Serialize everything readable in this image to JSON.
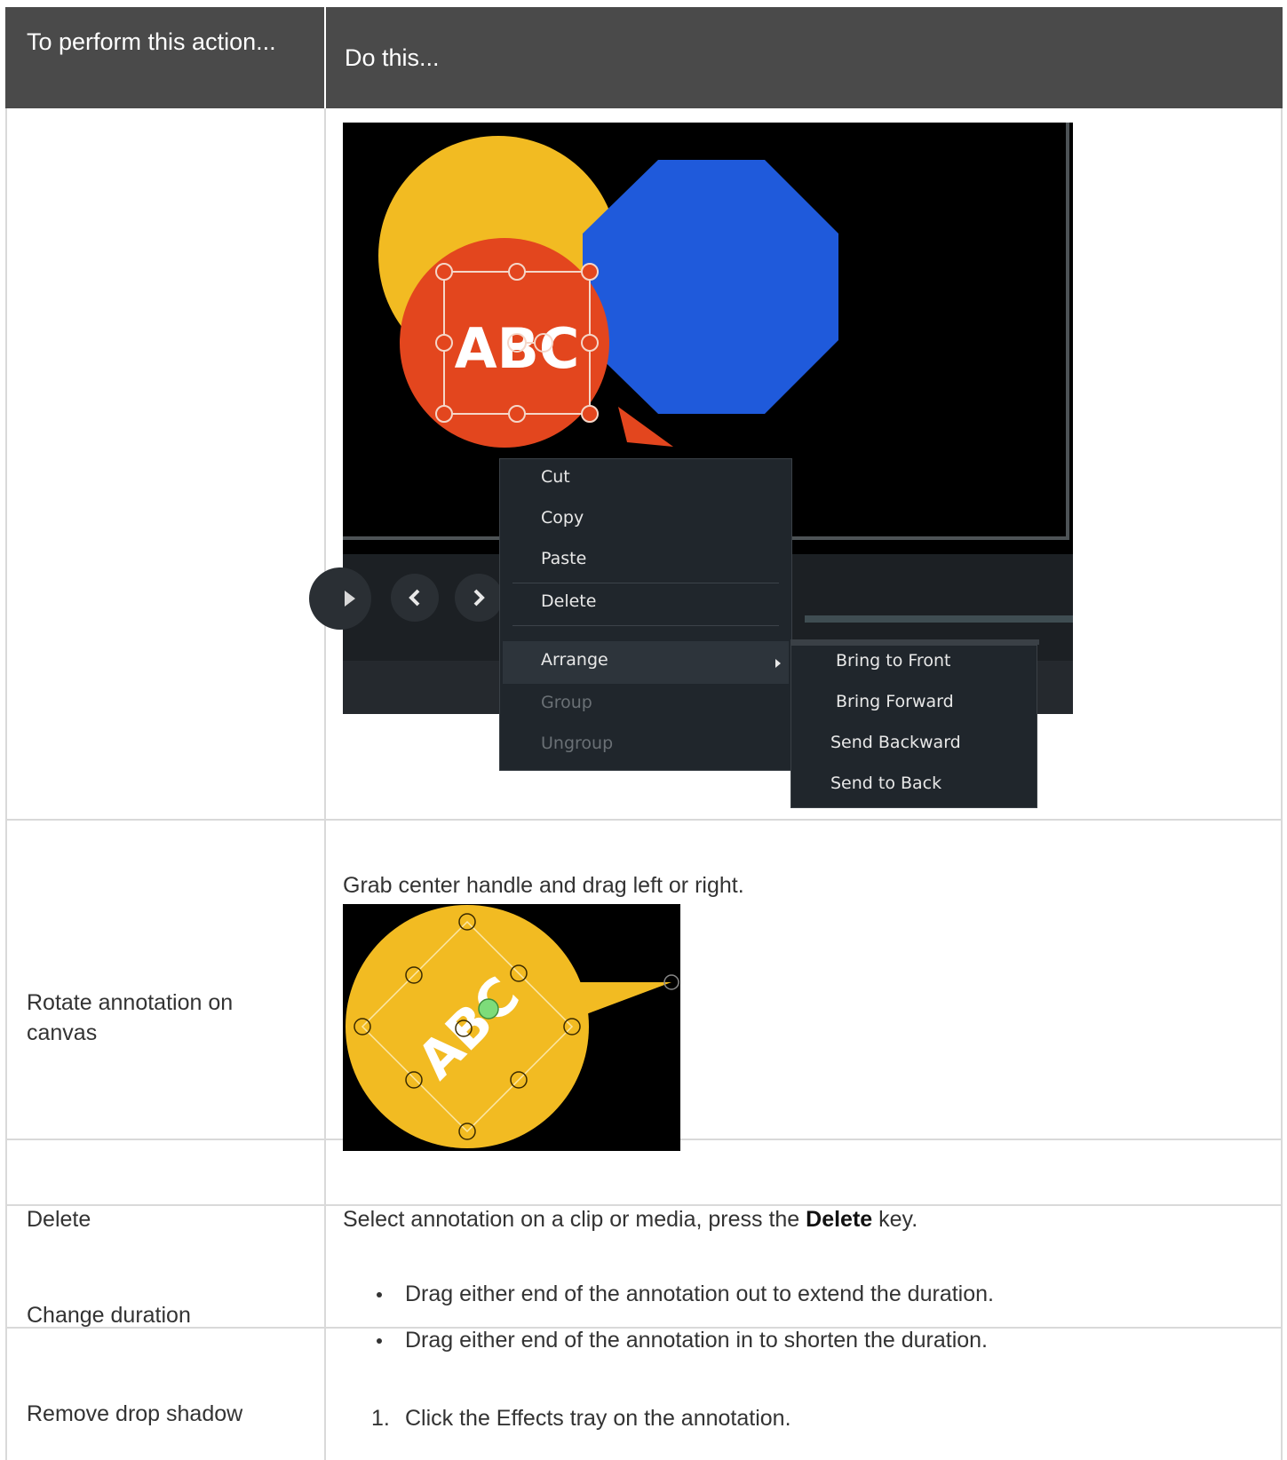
{
  "header": {
    "col1": "To perform this action...",
    "col2": "Do this..."
  },
  "arrange_screenshot": {
    "annotation_text": "ABC",
    "context_menu": {
      "items": [
        "Cut",
        "Copy",
        "Paste",
        "Delete",
        "Arrange",
        "Group",
        "Ungroup"
      ],
      "disabled": [
        "Group",
        "Ungroup"
      ],
      "highlighted": "Arrange"
    },
    "submenu": {
      "items": [
        "Bring to Front",
        "Bring Forward",
        "Send Backward",
        "Send to Back"
      ]
    },
    "colors": {
      "yellow_circle": "#f2bb22",
      "orange_callout": "#e3461e",
      "blue_octagon": "#1f5adb",
      "menu_bg": "#20262c"
    }
  },
  "rows": [
    {
      "action": "Rotate annotation on canvas",
      "instruction": "Grab center handle and drag left or right.",
      "screenshot_text": "ABC"
    },
    {
      "action": "Delete",
      "instruction_prefix": "Select annotation on a clip or media, press the ",
      "instruction_key": "Delete",
      "instruction_suffix": " key."
    },
    {
      "action": "Change duration",
      "bullets": [
        "Drag either end of the annotation out to extend the duration.",
        "Drag either end of the annotation in to shorten the duration."
      ]
    },
    {
      "action": "Remove drop shadow",
      "steps": [
        "Click the Effects tray on the annotation."
      ],
      "step_number": "1."
    }
  ]
}
